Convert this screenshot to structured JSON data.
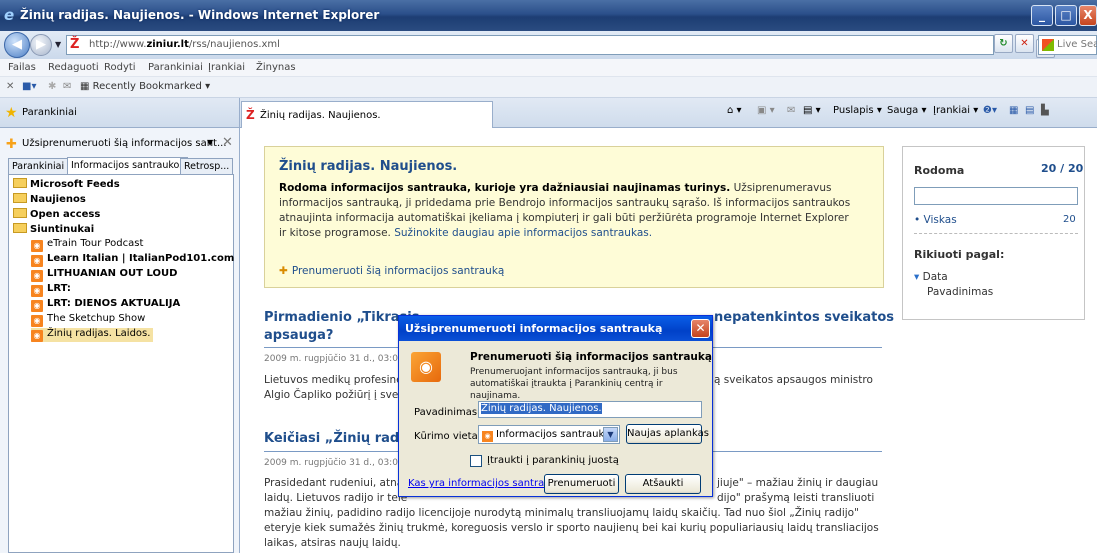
{
  "window": {
    "title": "Žinių radijas. Naujienos. - Windows Internet Explorer",
    "buttons": {
      "minimize": "_",
      "maximize": "□",
      "close": "X"
    }
  },
  "address": {
    "url_prefix": "http://www.",
    "url_domain": "ziniur.lt",
    "url_path": "/rss/naujienos.xml",
    "search_placeholder": "Live Search"
  },
  "menu": [
    "Failas",
    "Redaguoti",
    "Rodyti",
    "Parankiniai",
    "Įrankiai",
    "Žinynas"
  ],
  "favbar": {
    "recently_bookmarked": "Recently Bookmarked"
  },
  "tabs": {
    "favorites_label": "Parankiniai",
    "page_tab": "Žinių radijas. Naujienos."
  },
  "commandbar": {
    "page": "Puslapis",
    "safety": "Sauga",
    "tools": "Įrankiai"
  },
  "favorites_pane": {
    "subscribe_header": "Užsiprenumeruoti šią informacijos sant...",
    "tabs": [
      "Parankiniai",
      "Informacijos santraukos",
      "Retrosp..."
    ],
    "tree": [
      {
        "label": "Microsoft Feeds",
        "type": "folder"
      },
      {
        "label": "Naujienos",
        "type": "folder"
      },
      {
        "label": "Open access",
        "type": "folder"
      },
      {
        "label": "Siuntinukai",
        "type": "folder"
      },
      {
        "label": "eTrain Tour Podcast",
        "type": "feed"
      },
      {
        "label": "Learn Italian | ItalianPod101.com",
        "type": "feed"
      },
      {
        "label": "LITHUANIAN OUT LOUD",
        "type": "feed"
      },
      {
        "label": "LRT:",
        "type": "feed"
      },
      {
        "label": "LRT: DIENOS AKTUALIJA",
        "type": "feed"
      },
      {
        "label": "The Sketchup Show",
        "type": "feed"
      },
      {
        "label": "Žinių radijas. Laidos.",
        "type": "feed"
      }
    ]
  },
  "feed": {
    "title": "Žinių radijas. Naujienos.",
    "desc_bold": "Rodoma informacijos santrauka, kurioje yra dažniausiai naujinamas turinys.",
    "desc": " Užsiprenumeravus informacijos santrauką, ji pridedama prie Bendrojo informacijos santraukų sąrašo. Iš informacijos santraukos atnaujinta informacija automatiškai įkeliama į kompiuterį ir gali būti peržiūrėta programoje Internet Explorer ir kitose programose. ",
    "desc_link": "Sužinokite daugiau apie informacijos santraukas.",
    "subscribe_link": "Prenumeruoti šią informacijos santrauką"
  },
  "sidebox": {
    "shown_label": "Rodoma",
    "shown_count": "20 / 20",
    "all_label": "Viskas",
    "all_count": "20",
    "sort_label": "Rikiuoti pagal:",
    "sort_date": "Data",
    "sort_name": "Pavadinimas"
  },
  "articles": [
    {
      "title_left": "Pirmadienio „Tikrasis",
      "title_right": "nepatenkintos sveikatos",
      "title_line2": "apsauga?",
      "date": "2009 m. rugpjūčio 31 d., 03:00",
      "body_left": "Lietuvos medikų profesinė",
      "body_right": "ą sveikatos apsaugos ministro",
      "body_line2": "Algio Čapliko požiūrį į sveil"
    },
    {
      "title_left": "Keičiasi „Žinių radijo",
      "date": "2009 m. rugpjūčio 31 d., 03:00",
      "body_l1_left": "Prasidedant rudeniui, atnau",
      "body_l1_right": "jiuje\" – mažiau žinių ir daugiau",
      "body_l2_left": "laidų. Lietuvos radijo ir tele",
      "body_l2_right": "dijo\" prašymą leisti transliuoti",
      "body_rest": "mažiau žinių, padidino radijo licencijoje nurodytą minimalų transliuojamų laidų skaičių. Tad nuo šiol „Žinių radijo\" eteryje kiek sumažės žinių trukmė, koreguosis verslo ir sporto naujienų bei kai kurių populiariausių laidų transliacijos laikas, atsiras naujų laidų."
    }
  ],
  "dialog": {
    "title": "Užsiprenumeruoti informacijos santrauką",
    "heading": "Prenumeruoti šią informacijos santrauką",
    "description": "Prenumeruojant informacijos santrauką, ji bus automatiškai įtraukta į Parankinių centrą ir naujinama.",
    "name_label": "Pavadinimas:",
    "name_value": "Žinių radijas. Naujienos.",
    "location_label": "Kūrimo vieta:",
    "location_value": "Informacijos santraukos",
    "new_folder": "Naujas aplankas",
    "checkbox_label": "Įtraukti į parankinių juostą",
    "help_link": "Kas yra informacijos santrauka?",
    "subscribe": "Prenumeruoti",
    "cancel": "Atšaukti"
  }
}
